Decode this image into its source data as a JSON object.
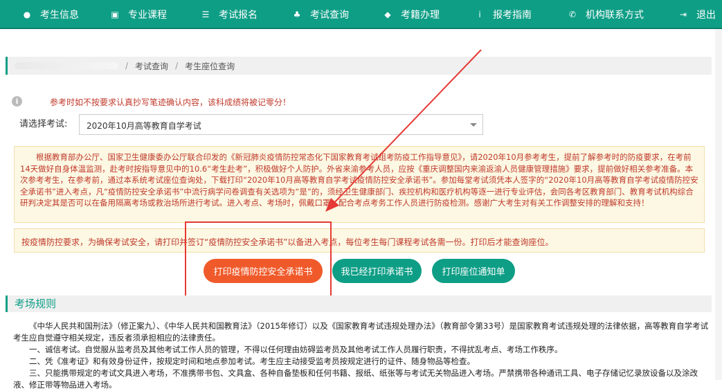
{
  "nav": {
    "items": [
      {
        "icon": "user-icon",
        "glyph": "●",
        "label": "考生信息"
      },
      {
        "icon": "book-icon",
        "glyph": "▣",
        "label": "专业课程"
      },
      {
        "icon": "list-icon",
        "glyph": "☰",
        "label": "考试报名"
      },
      {
        "icon": "sitemap-icon",
        "glyph": "♣",
        "label": "考试查询"
      },
      {
        "icon": "tag-icon",
        "glyph": "◆",
        "label": "考籍办理"
      },
      {
        "icon": "info-icon",
        "glyph": "i",
        "label": "报考指南"
      },
      {
        "icon": "phone-icon",
        "glyph": "✆",
        "label": "机构联系方式"
      },
      {
        "icon": "logout-icon",
        "glyph": "⇥",
        "label": "退出"
      }
    ]
  },
  "breadcrumb": {
    "items": [
      "考试查询",
      "考生座位查询"
    ]
  },
  "warning": "参考时如不按要求认真抄写笔迹确认内容，该科成绩将被记零分！",
  "exam_select": {
    "label": "请选择考试",
    "value": "2020年10月高等教育自学考试"
  },
  "notice": "根据教育部办公厅、国家卫生健康委办公厅联合印发的《新冠肺炎疫情防控常态化下国家教育考试组考防疫工作指导意见》，请2020年10月参考考生，提前了解参考时的防疫要求，在考前14天做好自身体温监测，赴考时按指导意见中的10.6“考生赴考”，积极做好个人防护。外省来渝参考人员，应按《重庆调整国内来渝返渝人员健康管理措施》要求，提前做好相关参考准备。本次参考考生，在参考前，通过本系统考试座位查询处，下载打印“2020年10月高等教育自学考试疫情防控安全承诺书”。参加每堂考试须凭本人签字的“2020年10月高等教育自学考试疫情防控安全承诺书”进入考点，凡“疫情防控安全承诺书”中流行病学问卷调查有关选项为“是”的，须经卫生健康部门、疾控机构和医疗机构等逐一进行专业评估，会同各考区教育部门、教育考试机构综合研判决定其是否可以在备用隔离考场或救治场所进行考试。进入考点、考场时，佩戴口罩，配合考点考务工作人员进行防疫检测。感谢广大考生对有关工作调整安排的理解和支持！",
  "notice2": "按疫情防控要求，为确保考试安全，请打印并签订“疫情防控安全承诺书”以备进入考点，每位考生每门课程考试各需一份。打印后才能查询座位。",
  "buttons": {
    "print_pledge": "打印疫情防控安全承诺书",
    "printed": "我已经打印承诺书",
    "print_seat": "打印座位通知单"
  },
  "section": {
    "title": "考场规则"
  },
  "rules": {
    "intro": "《中华人民共和国刑法》（修正案九）、《中华人民共和国教育法》（2015年修订）以及《国家教育考试违规处理办法》（教育部令第33号）是国家教育考试违规处理的法律依据，高等教育自学考试考生应自觉遵守相关规定，违反者须承担相应的法律责任。",
    "items": [
      "一、诚信考试。自觉服从监考员及其他考试工作人员的管理，不得以任何理由妨碍监考员及其他考试工作人员履行职责，不得扰乱考点、考场工作秩序。",
      "二、凭《准考证》和有效身份证件，按规定时间和地点参加考试。考生应主动接受监考员按规定进行的证件、随身物品等检查。",
      "三、只能携带规定的考试文具进入考场，不准携带书包、文具盒、各种自备垫板和任何书籍、报纸、纸张等与考试无关物品进入考场。严禁携带各种通讯工具、电子存储记忆录放设备以及涂改液、修正带等物品进入考场。"
    ]
  },
  "colors": {
    "nav_bg": "#0e9e86",
    "accent_orange": "#f05a2a",
    "accent_teal": "#0e9e86",
    "notice_text": "#c0392b",
    "annotation_red": "#e53935"
  }
}
